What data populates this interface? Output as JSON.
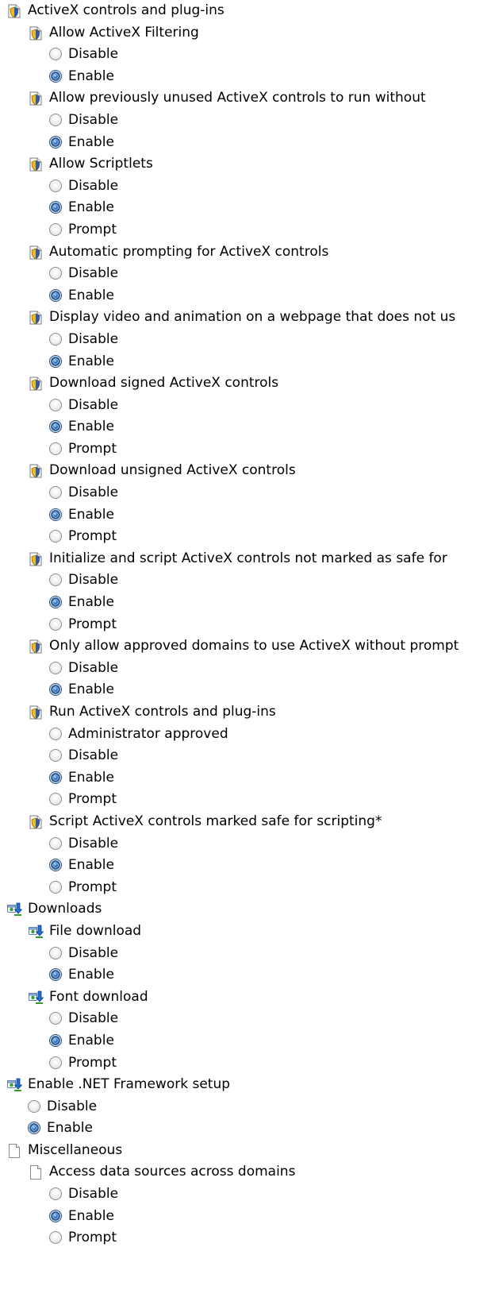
{
  "tree": [
    {
      "type": "folder",
      "icon": "shield-icon",
      "depth": 0,
      "label": "ActiveX controls and plug-ins"
    },
    {
      "type": "setting",
      "icon": "shield-icon",
      "depth": 1,
      "label": "Allow ActiveX Filtering"
    },
    {
      "type": "option",
      "depth": 2,
      "label": "Disable",
      "checked": false
    },
    {
      "type": "option",
      "depth": 2,
      "label": "Enable",
      "checked": true
    },
    {
      "type": "setting",
      "icon": "shield-icon",
      "depth": 1,
      "label": "Allow previously unused ActiveX controls to run without"
    },
    {
      "type": "option",
      "depth": 2,
      "label": "Disable",
      "checked": false
    },
    {
      "type": "option",
      "depth": 2,
      "label": "Enable",
      "checked": true
    },
    {
      "type": "setting",
      "icon": "shield-icon",
      "depth": 1,
      "label": "Allow Scriptlets"
    },
    {
      "type": "option",
      "depth": 2,
      "label": "Disable",
      "checked": false
    },
    {
      "type": "option",
      "depth": 2,
      "label": "Enable",
      "checked": true
    },
    {
      "type": "option",
      "depth": 2,
      "label": "Prompt",
      "checked": false
    },
    {
      "type": "setting",
      "icon": "shield-icon",
      "depth": 1,
      "label": "Automatic prompting for ActiveX controls"
    },
    {
      "type": "option",
      "depth": 2,
      "label": "Disable",
      "checked": false
    },
    {
      "type": "option",
      "depth": 2,
      "label": "Enable",
      "checked": true
    },
    {
      "type": "setting",
      "icon": "shield-icon",
      "depth": 1,
      "label": "Display video and animation on a webpage that does not us"
    },
    {
      "type": "option",
      "depth": 2,
      "label": "Disable",
      "checked": false
    },
    {
      "type": "option",
      "depth": 2,
      "label": "Enable",
      "checked": true
    },
    {
      "type": "setting",
      "icon": "shield-icon",
      "depth": 1,
      "label": "Download signed ActiveX controls"
    },
    {
      "type": "option",
      "depth": 2,
      "label": "Disable",
      "checked": false
    },
    {
      "type": "option",
      "depth": 2,
      "label": "Enable",
      "checked": true
    },
    {
      "type": "option",
      "depth": 2,
      "label": "Prompt",
      "checked": false
    },
    {
      "type": "setting",
      "icon": "shield-icon",
      "depth": 1,
      "label": "Download unsigned ActiveX controls"
    },
    {
      "type": "option",
      "depth": 2,
      "label": "Disable",
      "checked": false
    },
    {
      "type": "option",
      "depth": 2,
      "label": "Enable",
      "checked": true
    },
    {
      "type": "option",
      "depth": 2,
      "label": "Prompt",
      "checked": false
    },
    {
      "type": "setting",
      "icon": "shield-icon",
      "depth": 1,
      "label": "Initialize and script ActiveX controls not marked as safe for"
    },
    {
      "type": "option",
      "depth": 2,
      "label": "Disable",
      "checked": false
    },
    {
      "type": "option",
      "depth": 2,
      "label": "Enable",
      "checked": true
    },
    {
      "type": "option",
      "depth": 2,
      "label": "Prompt",
      "checked": false
    },
    {
      "type": "setting",
      "icon": "shield-icon",
      "depth": 1,
      "label": "Only allow approved domains to use ActiveX without prompt"
    },
    {
      "type": "option",
      "depth": 2,
      "label": "Disable",
      "checked": false
    },
    {
      "type": "option",
      "depth": 2,
      "label": "Enable",
      "checked": true
    },
    {
      "type": "setting",
      "icon": "shield-icon",
      "depth": 1,
      "label": "Run ActiveX controls and plug-ins"
    },
    {
      "type": "option",
      "depth": 2,
      "label": "Administrator approved",
      "checked": false
    },
    {
      "type": "option",
      "depth": 2,
      "label": "Disable",
      "checked": false
    },
    {
      "type": "option",
      "depth": 2,
      "label": "Enable",
      "checked": true
    },
    {
      "type": "option",
      "depth": 2,
      "label": "Prompt",
      "checked": false
    },
    {
      "type": "setting",
      "icon": "shield-icon",
      "depth": 1,
      "label": "Script ActiveX controls marked safe for scripting*"
    },
    {
      "type": "option",
      "depth": 2,
      "label": "Disable",
      "checked": false
    },
    {
      "type": "option",
      "depth": 2,
      "label": "Enable",
      "checked": true
    },
    {
      "type": "option",
      "depth": 2,
      "label": "Prompt",
      "checked": false
    },
    {
      "type": "folder",
      "icon": "download-icon",
      "depth": 0,
      "label": "Downloads"
    },
    {
      "type": "setting",
      "icon": "download-icon",
      "depth": 1,
      "label": "File download"
    },
    {
      "type": "option",
      "depth": 2,
      "label": "Disable",
      "checked": false
    },
    {
      "type": "option",
      "depth": 2,
      "label": "Enable",
      "checked": true
    },
    {
      "type": "setting",
      "icon": "download-icon",
      "depth": 1,
      "label": "Font download"
    },
    {
      "type": "option",
      "depth": 2,
      "label": "Disable",
      "checked": false
    },
    {
      "type": "option",
      "depth": 2,
      "label": "Enable",
      "checked": true
    },
    {
      "type": "option",
      "depth": 2,
      "label": "Prompt",
      "checked": false
    },
    {
      "type": "folder",
      "icon": "download-icon",
      "depth": 0,
      "label": "Enable .NET Framework setup"
    },
    {
      "type": "option",
      "depth": 1,
      "label": "Disable",
      "checked": false
    },
    {
      "type": "option",
      "depth": 1,
      "label": "Enable",
      "checked": true
    },
    {
      "type": "folder",
      "icon": "page-icon",
      "depth": 0,
      "label": "Miscellaneous"
    },
    {
      "type": "setting",
      "icon": "page-icon",
      "depth": 1,
      "label": "Access data sources across domains"
    },
    {
      "type": "option",
      "depth": 2,
      "label": "Disable",
      "checked": false
    },
    {
      "type": "option",
      "depth": 2,
      "label": "Enable",
      "checked": true
    },
    {
      "type": "option",
      "depth": 2,
      "label": "Prompt",
      "checked": false
    }
  ],
  "colors": {
    "shield_blue": "#2b59b7",
    "shield_gold": "#f2b81c",
    "download_green": "#2f9e2f",
    "download_blue": "#1f6fd1",
    "radio_checked": "#2c78cc"
  }
}
